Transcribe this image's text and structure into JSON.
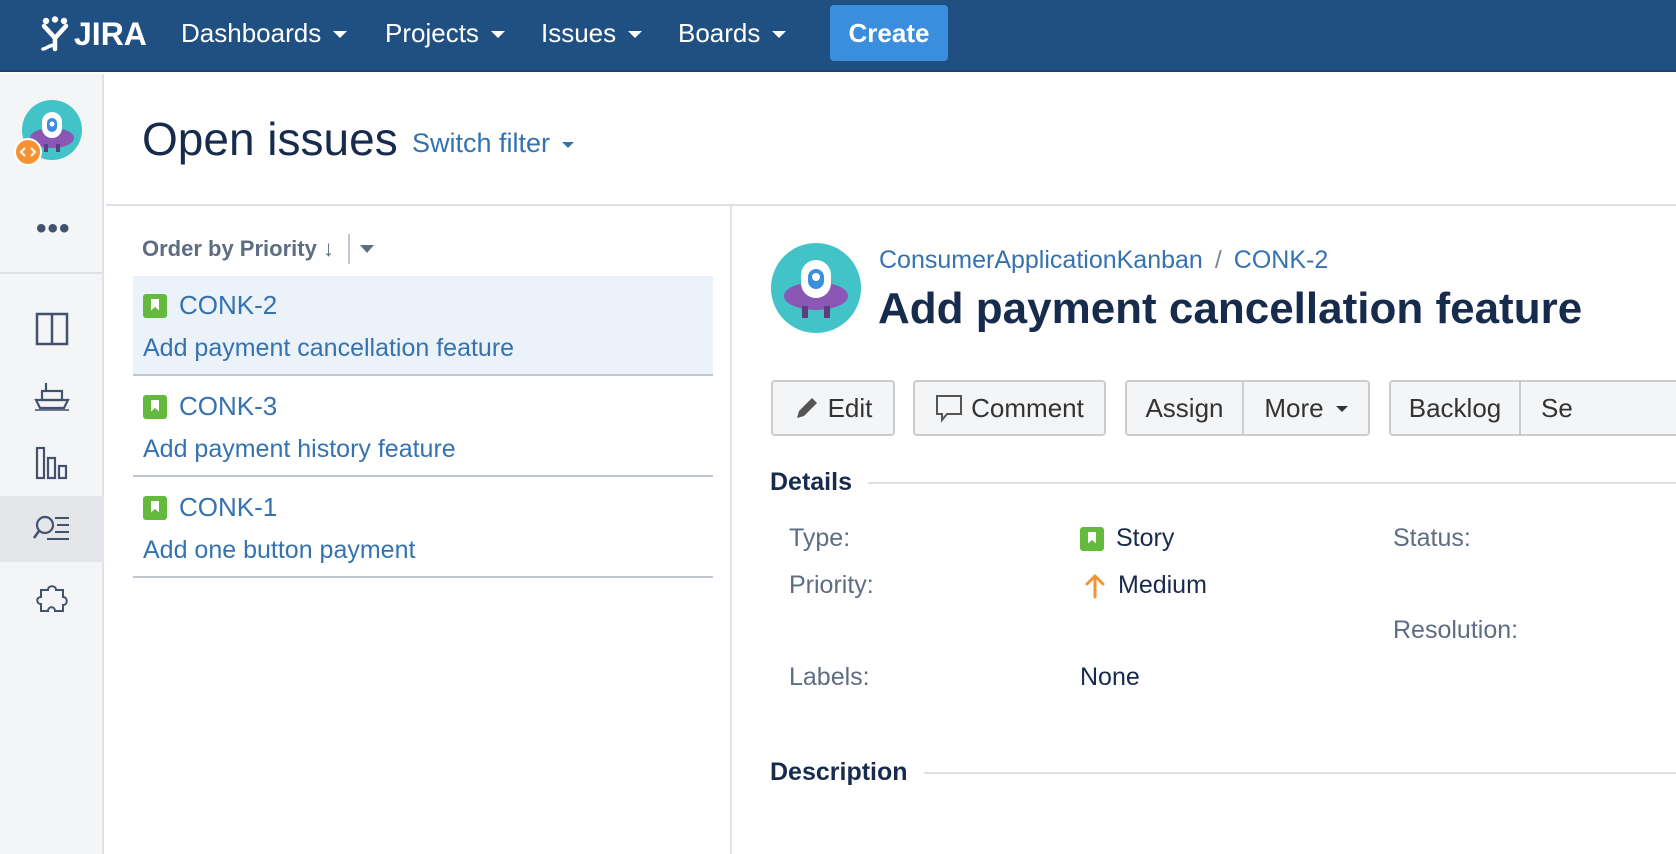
{
  "topnav": {
    "logo_text": "JIRA",
    "items": [
      {
        "label": "Dashboards"
      },
      {
        "label": "Projects"
      },
      {
        "label": "Issues"
      },
      {
        "label": "Boards"
      }
    ],
    "create_label": "Create",
    "bg_color": "#205081",
    "create_color": "#3b8ddd"
  },
  "sidebar": {
    "more_label": "•••",
    "icons": [
      "board-columns-icon",
      "ship-icon",
      "reports-icon",
      "issue-search-icon",
      "addons-icon"
    ],
    "active_icon": "issue-search-icon"
  },
  "header": {
    "title": "Open issues",
    "switch_filter": "Switch filter"
  },
  "list": {
    "order_label": "Order by Priority",
    "order_arrow": "↓",
    "issues": [
      {
        "key": "CONK-2",
        "summary": "Add payment cancellation feature",
        "selected": true
      },
      {
        "key": "CONK-3",
        "summary": "Add payment history feature",
        "selected": false
      },
      {
        "key": "CONK-1",
        "summary": "Add one button payment",
        "selected": false
      }
    ]
  },
  "detail": {
    "project": "ConsumerApplicationKanban",
    "breadcrumb_sep": "/",
    "key": "CONK-2",
    "title": "Add payment cancellation feature",
    "buttons": {
      "edit": "Edit",
      "comment": "Comment",
      "assign": "Assign",
      "more": "More",
      "backlog": "Backlog",
      "selected_partial": "Se"
    },
    "details_heading": "Details",
    "fields": {
      "type_label": "Type:",
      "type_value": "Story",
      "priority_label": "Priority:",
      "priority_value": "Medium",
      "labels_label": "Labels:",
      "labels_value": "None",
      "status_label": "Status:",
      "resolution_label": "Resolution:"
    },
    "description_heading": "Description"
  },
  "colors": {
    "link": "#3572b0",
    "story_green": "#63ba3c",
    "priority_orange": "#f79232",
    "selected_row": "#ebf2f9"
  }
}
